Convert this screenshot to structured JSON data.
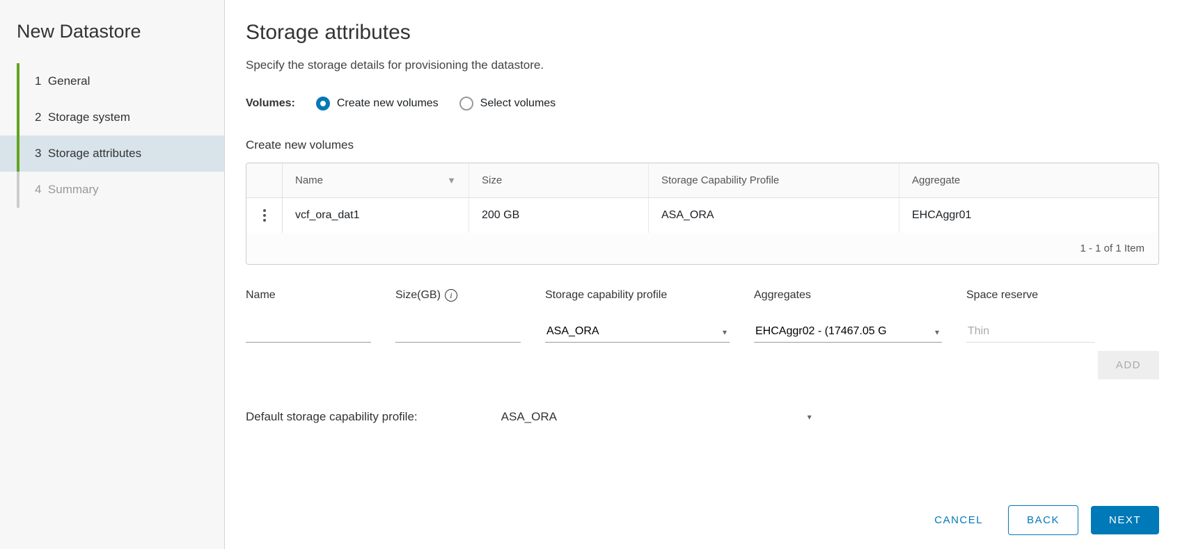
{
  "sidebar": {
    "title": "New Datastore",
    "steps": [
      {
        "num": "1",
        "label": "General"
      },
      {
        "num": "2",
        "label": "Storage system"
      },
      {
        "num": "3",
        "label": "Storage attributes"
      },
      {
        "num": "4",
        "label": "Summary"
      }
    ]
  },
  "page": {
    "title": "Storage attributes",
    "subtitle": "Specify the storage details for provisioning the datastore."
  },
  "volumes": {
    "label": "Volumes:",
    "opt_create": "Create new volumes",
    "opt_select": "Select volumes"
  },
  "section_heading": "Create new volumes",
  "table": {
    "headers": {
      "name": "Name",
      "size": "Size",
      "profile": "Storage Capability Profile",
      "aggregate": "Aggregate"
    },
    "rows": [
      {
        "name": "vcf_ora_dat1",
        "size": "200 GB",
        "profile": "ASA_ORA",
        "aggregate": "EHCAggr01"
      }
    ],
    "footer": "1 - 1 of 1 Item"
  },
  "form": {
    "labels": {
      "name": "Name",
      "size": "Size(GB)",
      "profile": "Storage capability profile",
      "aggregates": "Aggregates",
      "space_reserve": "Space reserve"
    },
    "values": {
      "name": "",
      "size": "",
      "profile": "ASA_ORA",
      "aggregates": "EHCAggr02 - (17467.05 G",
      "space_reserve_placeholder": "Thin"
    },
    "add_label": "ADD"
  },
  "default_profile": {
    "label": "Default storage capability profile:",
    "value": "ASA_ORA"
  },
  "footer": {
    "cancel": "CANCEL",
    "back": "BACK",
    "next": "NEXT"
  }
}
